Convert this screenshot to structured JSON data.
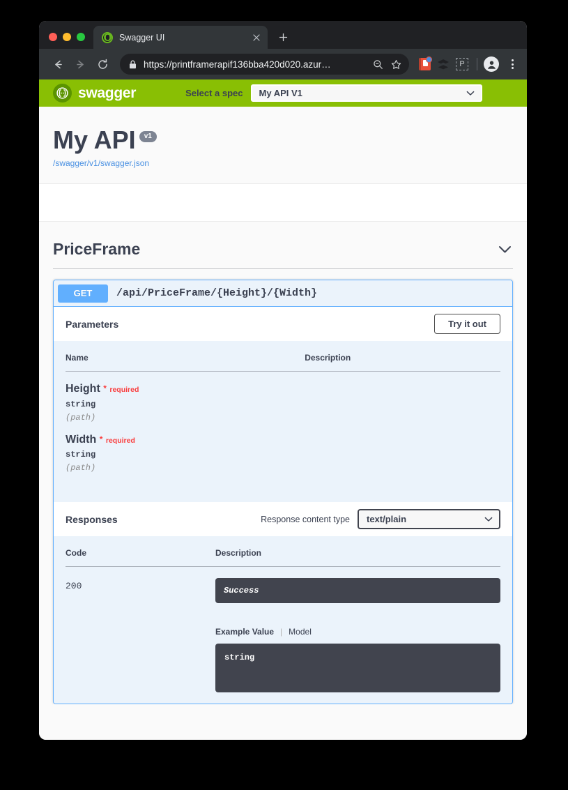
{
  "browser": {
    "tab": {
      "title": "Swagger UI",
      "favicon_icon": "swagger-favicon-icon",
      "close_icon": "close-icon"
    },
    "new_tab_label": "+",
    "nav": {
      "back_icon": "arrow-left-icon",
      "forward_icon": "arrow-right-icon",
      "reload_icon": "reload-icon"
    },
    "omnibox": {
      "lock_icon": "lock-icon",
      "url": "https://printframerapif136bba420d020.azur…",
      "zoom_out_icon": "zoom-out-icon",
      "bookmark_icon": "star-icon"
    },
    "extensions": [
      {
        "name": "bookmark-manager-extension-icon"
      },
      {
        "name": "layers-extension-icon"
      },
      {
        "name": "pocket-extension-icon",
        "glyph": "P"
      }
    ],
    "profile_icon": "account-avatar-icon",
    "menu_icon": "three-dots-menu-icon"
  },
  "topbar": {
    "logo_text": "swagger",
    "logo_icon": "swagger-logo-icon",
    "select_spec_label": "Select a spec",
    "selected_spec": "My API V1",
    "chevron_icon": "chevron-down-icon"
  },
  "info": {
    "title": "My API",
    "version_badge": "v1",
    "spec_url": "/swagger/v1/swagger.json"
  },
  "tag": {
    "name": "PriceFrame",
    "collapse_icon": "chevron-down-icon"
  },
  "operation": {
    "method": "GET",
    "path": "/api/PriceFrame/{Height}/{Width}",
    "parameters_section": {
      "title": "Parameters",
      "try_it_out_label": "Try it out",
      "columns": [
        "Name",
        "Description"
      ],
      "rows": [
        {
          "name": "Height",
          "required_star": "*",
          "required_label": "required",
          "type": "string",
          "in": "(path)",
          "description": ""
        },
        {
          "name": "Width",
          "required_star": "*",
          "required_label": "required",
          "type": "string",
          "in": "(path)",
          "description": ""
        }
      ]
    },
    "responses_section": {
      "title": "Responses",
      "content_type_label": "Response content type",
      "content_type_value": "text/plain",
      "columns": [
        "Code",
        "Description"
      ],
      "rows": [
        {
          "code": "200",
          "description": "Success",
          "example_tab_active": "Example Value",
          "example_tab": "Model",
          "example_value": "string"
        }
      ]
    }
  },
  "colors": {
    "swagger_green": "#89bf04",
    "get_blue": "#61affe",
    "dark_box": "#41444e",
    "required_red": "#f93e3e",
    "link_blue": "#4990e2",
    "text_dark": "#3b4151"
  }
}
